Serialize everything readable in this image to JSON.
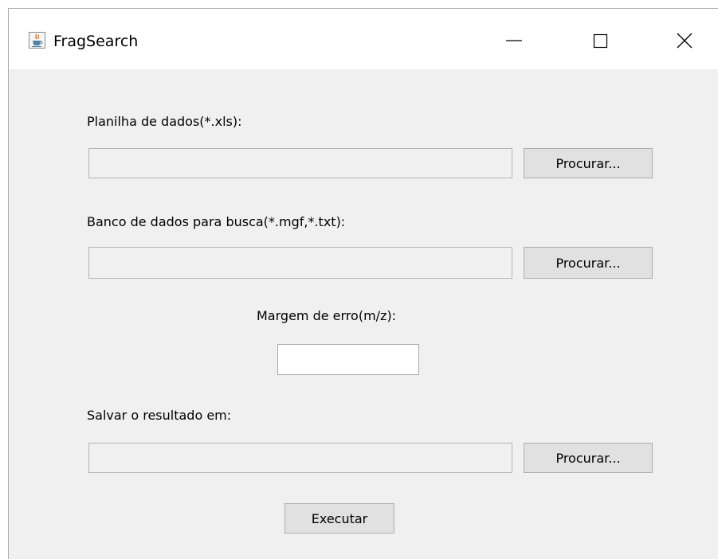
{
  "window": {
    "title": "FragSearch",
    "app_icon": "java-coffee-icon",
    "controls": {
      "minimize_icon": "minimize-icon",
      "maximize_icon": "maximize-icon",
      "close_icon": "close-icon"
    }
  },
  "form": {
    "spreadsheet": {
      "label": "Planilha de dados(*.xls):",
      "value": "",
      "browse_label": "Procurar..."
    },
    "database": {
      "label": "Banco de dados para busca(*.mgf,*.txt):",
      "value": "",
      "browse_label": "Procurar..."
    },
    "error_margin": {
      "label": "Margem de erro(m/z):",
      "value": ""
    },
    "output": {
      "label": "Salvar o resultado em:",
      "value": "",
      "browse_label": "Procurar..."
    },
    "execute_label": "Executar"
  },
  "colors": {
    "window_bg": "#f0f0f0",
    "titlebar_bg": "#ffffff",
    "button_bg": "#e1e1e1",
    "button_border": "#adadad"
  }
}
